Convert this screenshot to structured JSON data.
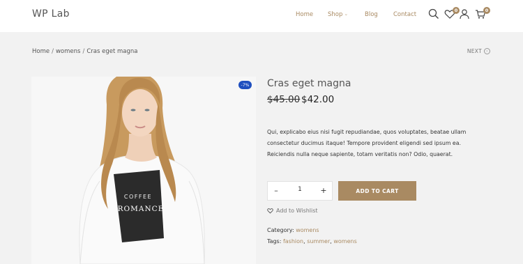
{
  "brand": {
    "logo": "WP Lab",
    "accent": "#a98a62",
    "sale_badge_color": "#1f4fbf"
  },
  "nav": {
    "items": [
      {
        "label": "Home"
      },
      {
        "label": "Shop",
        "has_dropdown": true
      },
      {
        "label": "Blog"
      },
      {
        "label": "Contact"
      }
    ],
    "icons": [
      "search-icon",
      "heart-icon",
      "user-icon",
      "cart-icon"
    ],
    "wishlist_count": "0",
    "cart_count": "0"
  },
  "breadcrumb": {
    "home": "Home",
    "category": "womens",
    "current": "Cras eget magna",
    "separator": "/"
  },
  "pager": {
    "next": "NEXT"
  },
  "product": {
    "title": "Cras eget magna",
    "discount": "-7%",
    "old_price": "$45.00",
    "price": "$42.00",
    "description": "Qui, explicabo eius nisi fugit repudiandae, quos voluptates, beatae ullam consectetur ducimus itaque! Tempore provident eligendi sed ipsum ea. Reiciendis nulla neque sapiente, totam veritatis non? Odio, quaerat.",
    "quantity": "1",
    "add_to_cart": "ADD TO CART",
    "wishlist": "Add to Wishlist",
    "category_label": "Category:",
    "category": "womens",
    "tags_label": "Tags:",
    "tags": [
      "fashion",
      "summer",
      "womens"
    ],
    "tag_separator": ",",
    "shirt_text_1": "COFFEE",
    "shirt_text_2": "ROMANCE"
  }
}
